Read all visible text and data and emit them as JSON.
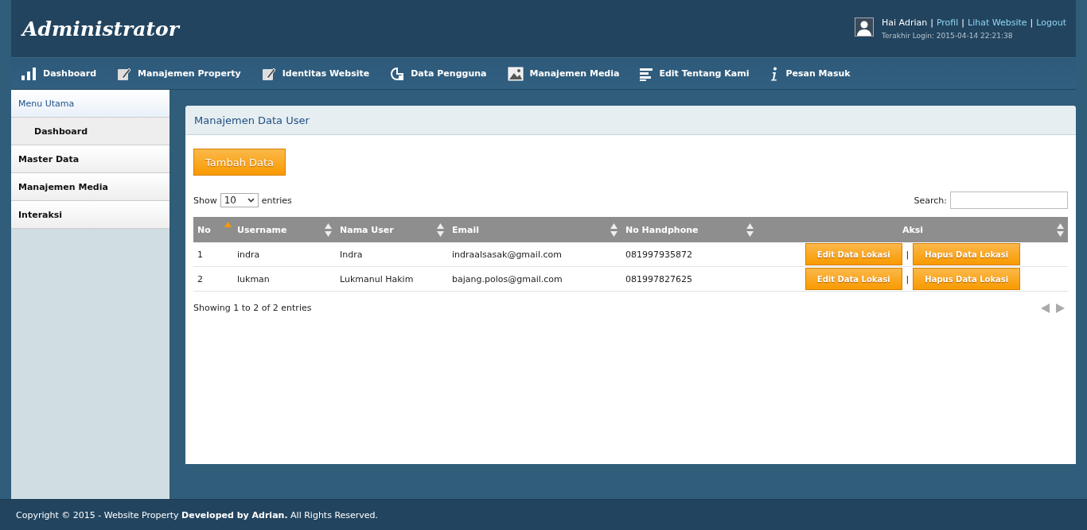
{
  "header": {
    "title": "Administrator",
    "greeting": "Hai Adrian",
    "links": [
      {
        "sep": "|",
        "label": "Profil"
      },
      {
        "sep": "|",
        "label": "Lihat Website"
      },
      {
        "sep": "|",
        "label": "Logout"
      }
    ],
    "last_login": "Terakhir Login: 2015-04-14 22:21:38"
  },
  "nav": [
    {
      "label": "Dashboard",
      "kind": "chart"
    },
    {
      "label": "Manajemen Property",
      "kind": "edit"
    },
    {
      "label": "Identitas Website",
      "kind": "edit"
    },
    {
      "label": "Data Pengguna",
      "kind": "pie"
    },
    {
      "label": "Manajemen Media",
      "kind": "image"
    },
    {
      "label": "Edit Tentang Kami",
      "kind": "lines"
    },
    {
      "label": "Pesan Masuk",
      "kind": "info"
    }
  ],
  "sidebar": {
    "items": [
      {
        "label": "Menu Utama",
        "kind": "header",
        "selected": false
      },
      {
        "label": "Dashboard",
        "kind": "sub",
        "selected": true
      },
      {
        "label": "Master Data",
        "kind": "item",
        "selected": false
      },
      {
        "label": "Manajemen Media",
        "kind": "item",
        "selected": false
      },
      {
        "label": "Interaksi",
        "kind": "item",
        "selected": false
      }
    ]
  },
  "panel": {
    "title": "Manajemen Data User",
    "add_button": "Tambah Data",
    "length": {
      "before": "Show",
      "value": "10",
      "after": "entries"
    },
    "search": {
      "label": "Search:"
    },
    "table": {
      "columns": [
        {
          "label": "No",
          "sorted": true
        },
        {
          "label": "Username",
          "sorted": false
        },
        {
          "label": "Nama User",
          "sorted": false
        },
        {
          "label": "Email",
          "sorted": false
        },
        {
          "label": "No Handphone",
          "sorted": false
        },
        {
          "label": "Aksi",
          "sorted": false
        }
      ],
      "rows": [
        {
          "cells": [
            "1",
            "indra",
            "Indra",
            "indraalsasak@gmail.com",
            "081997935872"
          ],
          "actions": [
            "Edit Data Lokasi",
            "|",
            "Hapus Data Lokasi"
          ]
        },
        {
          "cells": [
            "2",
            "lukman",
            "Lukmanul Hakim",
            "bajang.polos@gmail.com",
            "081997827625"
          ],
          "actions": [
            "Edit Data Lokasi",
            "|",
            "Hapus Data Lokasi"
          ]
        }
      ]
    },
    "info": "Showing 1 to 2 of 2 entries"
  },
  "footer": "Copyright © 2015 - Website Property **Developed by Adrian.** All Rights Reserved."
}
